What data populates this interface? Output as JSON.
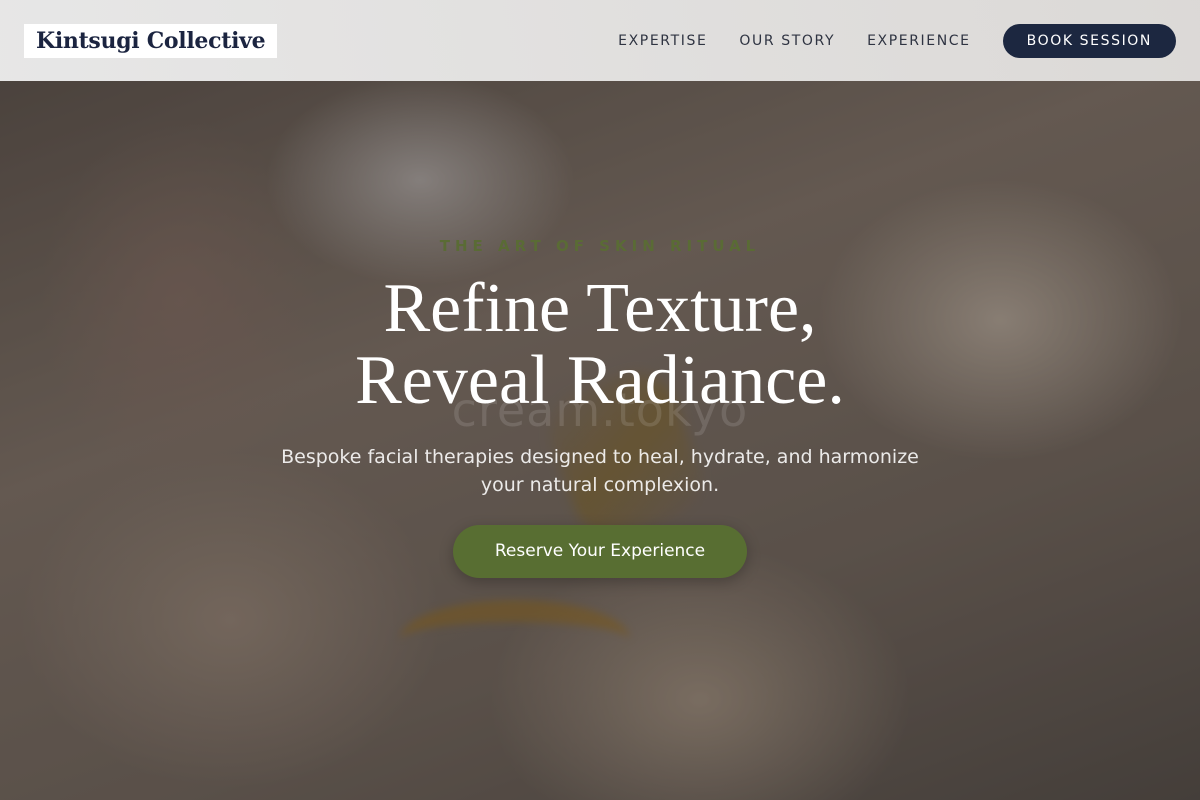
{
  "brand": {
    "logo_text": "Kintsugi Collective"
  },
  "nav": {
    "links": [
      "EXPERTISE",
      "OUR STORY",
      "EXPERIENCE"
    ],
    "book_label": "BOOK SESSION"
  },
  "hero": {
    "eyebrow": "THE ART OF SKIN RITUAL",
    "headline_line1": "Refine Texture,",
    "headline_line2": "Reveal Radiance.",
    "watermark": "cream.tokyo",
    "subtitle": "Bespoke facial therapies designed to heal, hydrate, and harmonize your natural complexion.",
    "cta_label": "Reserve Your Experience"
  },
  "colors": {
    "navy": "#1c2740",
    "olive_green": "#586e32",
    "eyebrow_green": "#5a6b35"
  }
}
